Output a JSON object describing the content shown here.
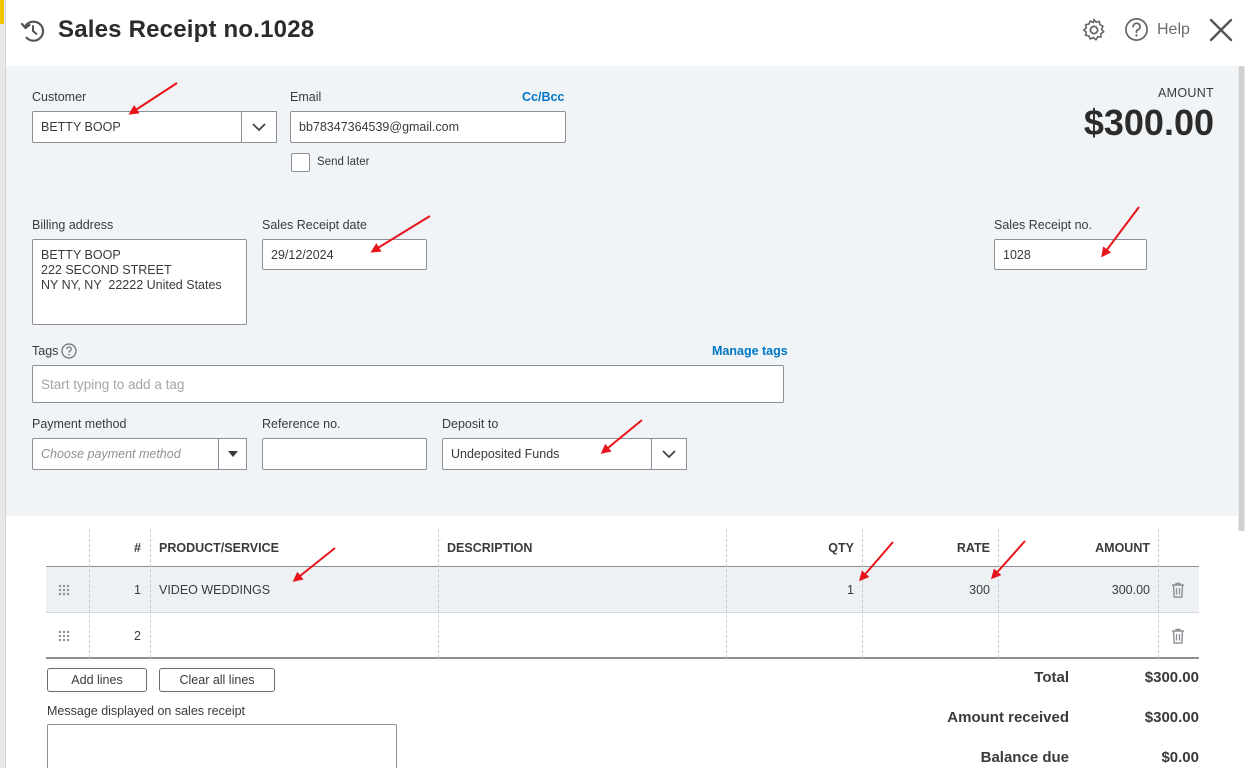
{
  "header": {
    "title": "Sales Receipt no.1028",
    "help_label": "Help",
    "icons": {
      "history": "history-icon",
      "settings": "gear-icon",
      "help": "question-circle-icon",
      "close": "close-icon"
    }
  },
  "customer": {
    "label": "Customer",
    "value": "BETTY BOOP"
  },
  "email": {
    "label": "Email",
    "value": "bb78347364539@gmail.com",
    "cc_bcc_link": "Cc/Bcc",
    "send_later_label": "Send later",
    "send_later_checked": false
  },
  "amount": {
    "label": "AMOUNT",
    "value": "$300.00"
  },
  "billing_address": {
    "label": "Billing address",
    "lines": [
      "BETTY BOOP",
      "222 SECOND STREET",
      "NY NY, NY  22222 United States"
    ]
  },
  "receipt_date": {
    "label": "Sales Receipt date",
    "value": "29/12/2024"
  },
  "receipt_no": {
    "label": "Sales Receipt no.",
    "value": "1028"
  },
  "tags": {
    "label": "Tags",
    "manage_link": "Manage tags",
    "placeholder": "Start typing to add a tag"
  },
  "payment_method": {
    "label": "Payment method",
    "placeholder": "Choose payment method"
  },
  "reference_no": {
    "label": "Reference no.",
    "value": ""
  },
  "deposit_to": {
    "label": "Deposit to",
    "value": "Undeposited Funds"
  },
  "table": {
    "headers": {
      "num": "#",
      "product": "PRODUCT/SERVICE",
      "description": "DESCRIPTION",
      "qty": "QTY",
      "rate": "RATE",
      "amount": "AMOUNT"
    },
    "rows": [
      {
        "num": "1",
        "product": "VIDEO WEDDINGS",
        "description": "",
        "qty": "1",
        "rate": "300",
        "amount": "300.00"
      },
      {
        "num": "2",
        "product": "",
        "description": "",
        "qty": "",
        "rate": "",
        "amount": ""
      }
    ]
  },
  "buttons": {
    "add_lines": "Add lines",
    "clear_all_lines": "Clear all lines"
  },
  "message": {
    "label": "Message displayed on sales receipt",
    "value": ""
  },
  "totals": {
    "total_label": "Total",
    "total_value": "$300.00",
    "received_label": "Amount received",
    "received_value": "$300.00",
    "balance_label": "Balance due",
    "balance_value": "$0.00"
  },
  "colors": {
    "accent_link": "#0077c5",
    "annotation_arrow": "#e8141b",
    "form_background": "#f0f4f7"
  }
}
